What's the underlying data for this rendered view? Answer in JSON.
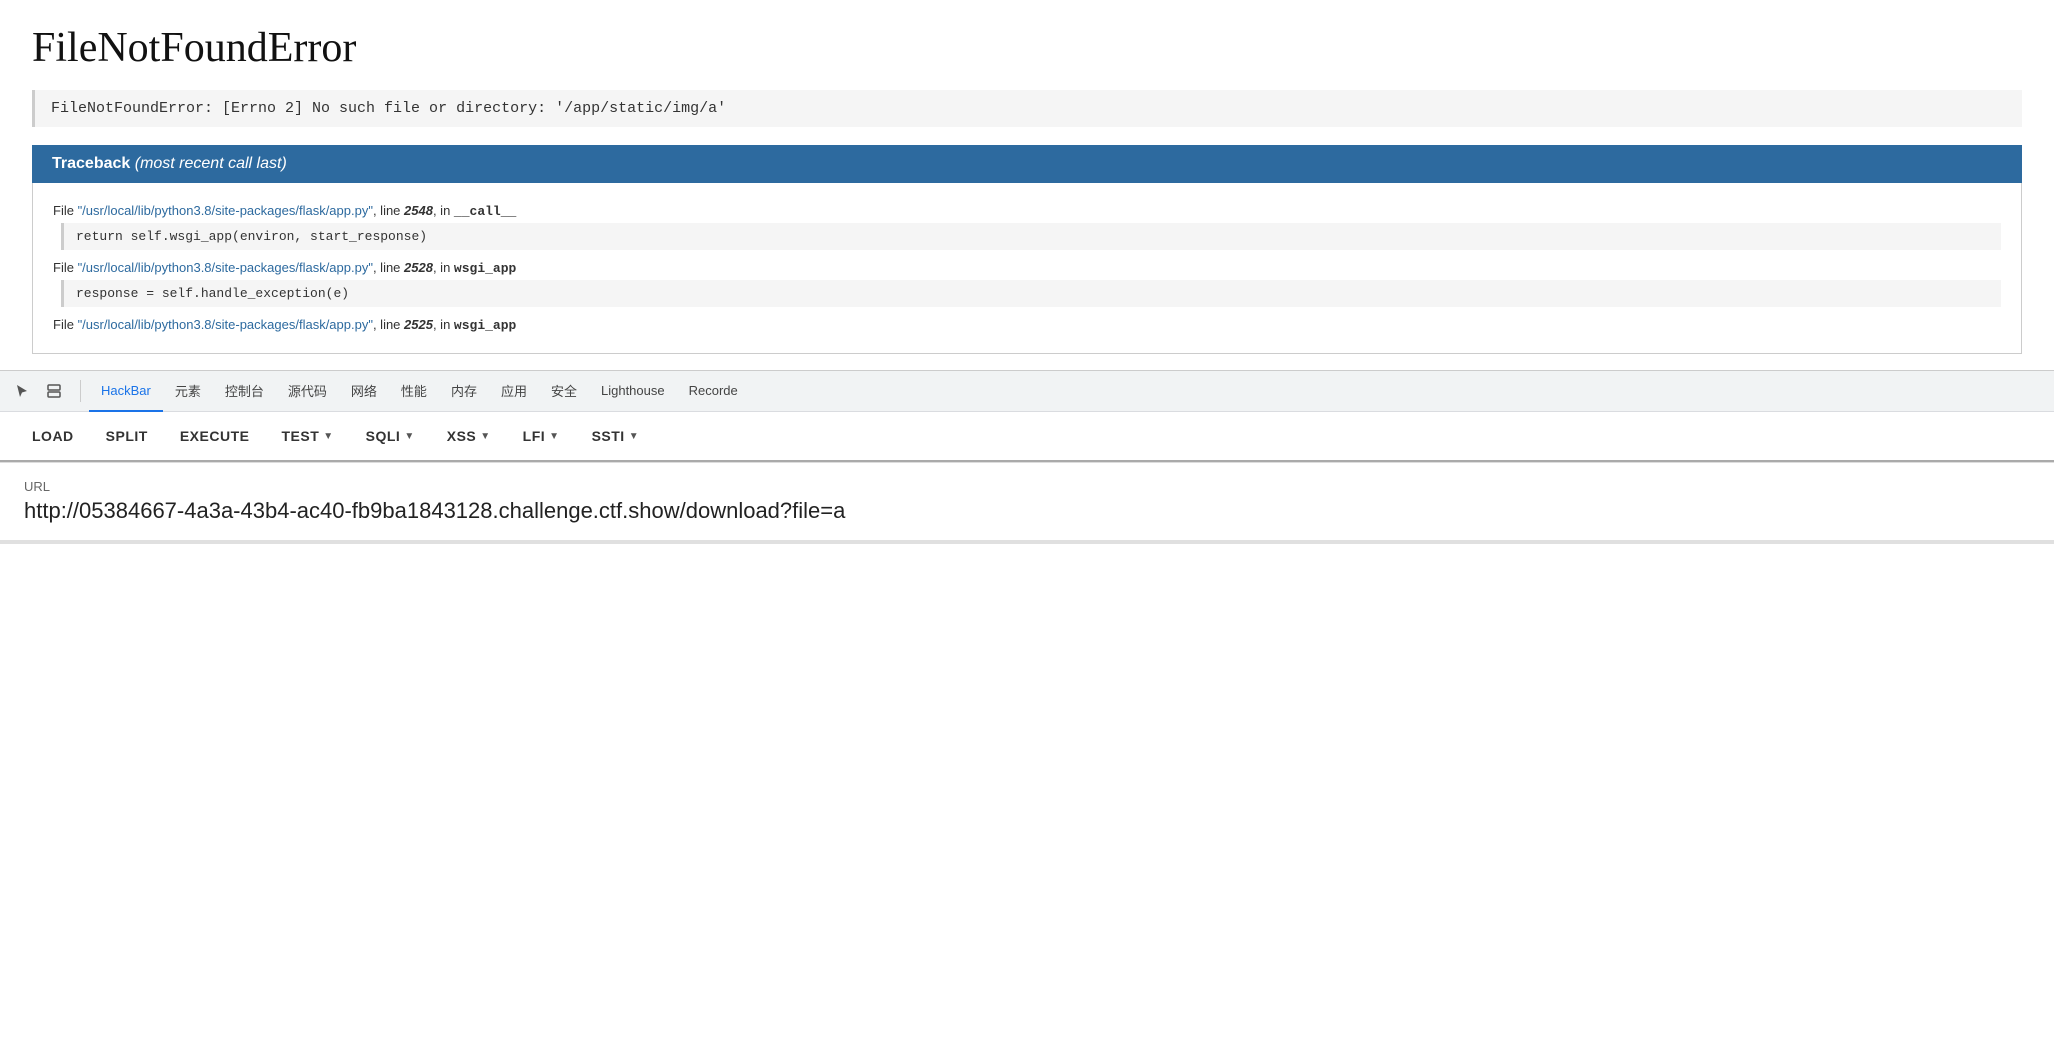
{
  "error": {
    "title": "FileNotFoundError",
    "subtitle": "FileNotFoundError: [Errno 2] No such file or directory: '/app/static/img/a'"
  },
  "traceback": {
    "header_label": "Traceback",
    "header_note": "(most recent call last)",
    "entries": [
      {
        "file_text": "File ",
        "file_path": "\"/usr/local/lib/python3.8/site-packages/flask/app.py\"",
        "line_label": ", line ",
        "line_num": "2548",
        "in_label": ", in ",
        "func_name": "__call__",
        "code": "return self.wsgi_app(environ, start_response)"
      },
      {
        "file_text": "File ",
        "file_path": "\"/usr/local/lib/python3.8/site-packages/flask/app.py\"",
        "line_label": ", line ",
        "line_num": "2528",
        "in_label": ", in ",
        "func_name": "wsgi_app",
        "code": "response = self.handle_exception(e)"
      },
      {
        "file_text": "File ",
        "file_path": "\"/usr/local/lib/python3.8/site-packages/flask/app.py\"",
        "line_label": ", line ",
        "line_num": "2525",
        "in_label": ", in ",
        "func_name": "wsgi_app",
        "code": ""
      }
    ]
  },
  "devtools": {
    "tabs": [
      {
        "id": "hackbar",
        "label": "HackBar",
        "active": true
      },
      {
        "id": "elements",
        "label": "元素",
        "active": false
      },
      {
        "id": "console",
        "label": "控制台",
        "active": false
      },
      {
        "id": "sources",
        "label": "源代码",
        "active": false
      },
      {
        "id": "network",
        "label": "网络",
        "active": false
      },
      {
        "id": "performance",
        "label": "性能",
        "active": false
      },
      {
        "id": "memory",
        "label": "内存",
        "active": false
      },
      {
        "id": "application",
        "label": "应用",
        "active": false
      },
      {
        "id": "security",
        "label": "安全",
        "active": false
      },
      {
        "id": "lighthouse",
        "label": "Lighthouse",
        "active": false
      },
      {
        "id": "recorder",
        "label": "Recorde",
        "active": false
      }
    ]
  },
  "hackbar": {
    "buttons": [
      {
        "id": "load",
        "label": "LOAD",
        "has_dropdown": false
      },
      {
        "id": "split",
        "label": "SPLIT",
        "has_dropdown": false
      },
      {
        "id": "execute",
        "label": "EXECUTE",
        "has_dropdown": false
      },
      {
        "id": "test",
        "label": "TEST",
        "has_dropdown": true
      },
      {
        "id": "sqli",
        "label": "SQLI",
        "has_dropdown": true
      },
      {
        "id": "xss",
        "label": "XSS",
        "has_dropdown": true
      },
      {
        "id": "lfi",
        "label": "LFI",
        "has_dropdown": true
      },
      {
        "id": "ssti",
        "label": "SSTI",
        "has_dropdown": true
      }
    ]
  },
  "url_section": {
    "label": "URL",
    "value": "http://05384667-4a3a-43b4-ac40-fb9ba1843128.challenge.ctf.show/download?file=a"
  }
}
